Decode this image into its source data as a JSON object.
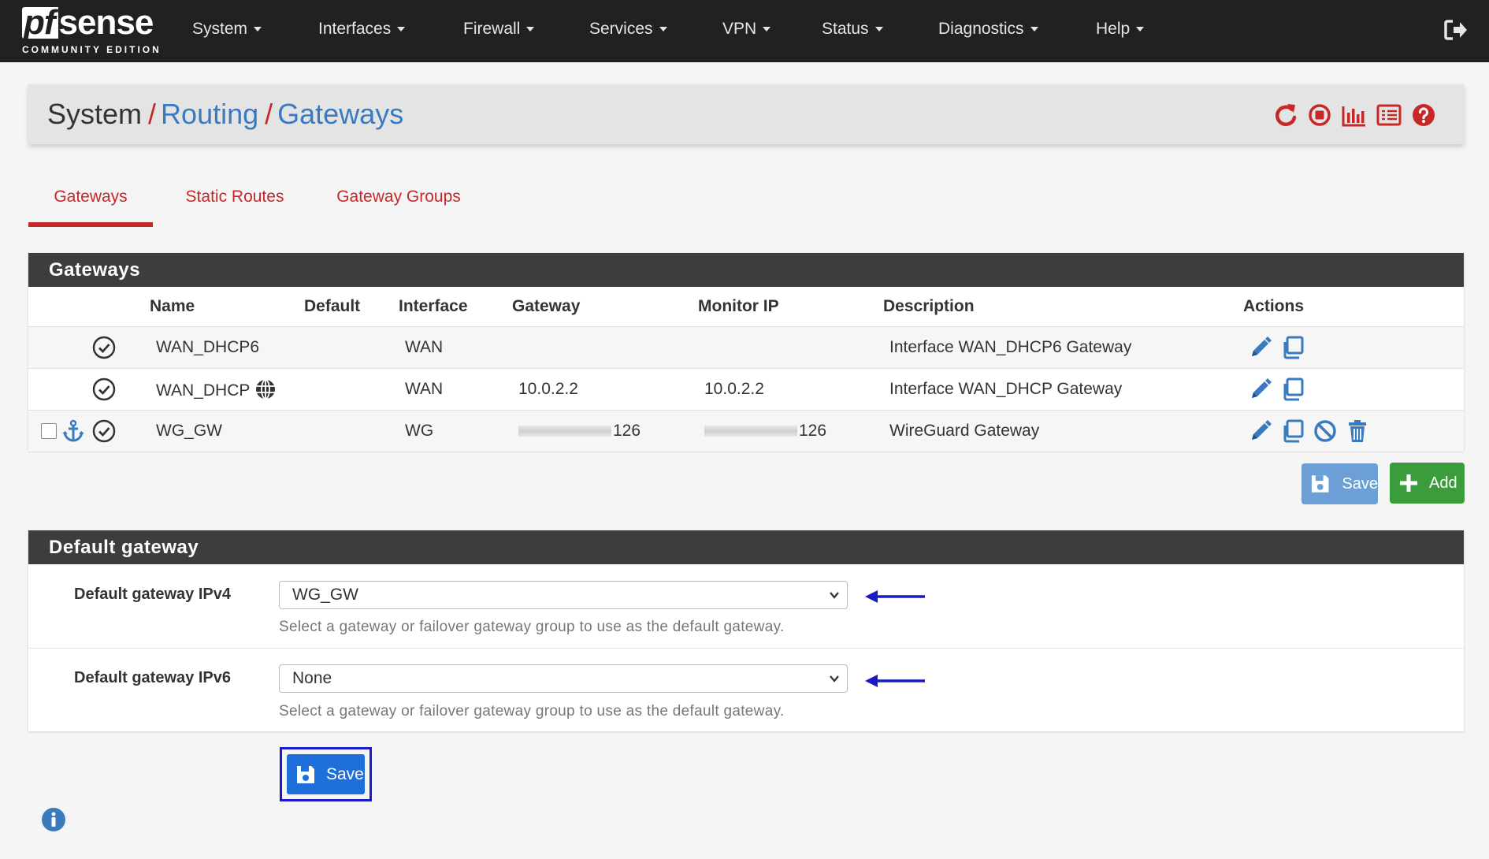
{
  "brand": {
    "logo_main": "sense",
    "logo_pf": "pf",
    "logo_sub": "COMMUNITY EDITION"
  },
  "nav": {
    "items": [
      {
        "label": "System"
      },
      {
        "label": "Interfaces"
      },
      {
        "label": "Firewall"
      },
      {
        "label": "Services"
      },
      {
        "label": "VPN"
      },
      {
        "label": "Status"
      },
      {
        "label": "Diagnostics"
      },
      {
        "label": "Help"
      }
    ]
  },
  "breadcrumb": {
    "root": "System",
    "sep": "/",
    "level1": "Routing",
    "level2": "Gateways"
  },
  "tabs": [
    {
      "label": "Gateways"
    },
    {
      "label": "Static Routes"
    },
    {
      "label": "Gateway Groups"
    }
  ],
  "gateways_panel": {
    "title": "Gateways",
    "columns": [
      "Name",
      "Default",
      "Interface",
      "Gateway",
      "Monitor IP",
      "Description",
      "Actions"
    ],
    "rows": [
      {
        "name": "WAN_DHCP6",
        "interface": "WAN",
        "gateway": "",
        "monitor_ip": "",
        "description": "Interface WAN_DHCP6 Gateway"
      },
      {
        "name": "WAN_DHCP",
        "interface": "WAN",
        "gateway": "10.0.2.2",
        "monitor_ip": "10.0.2.2",
        "description": "Interface WAN_DHCP Gateway"
      },
      {
        "name": "WG_GW",
        "interface": "WG",
        "gateway": "126",
        "monitor_ip": "126",
        "description": "WireGuard Gateway"
      }
    ],
    "save_label": "Save",
    "add_label": "Add"
  },
  "default_gateway_panel": {
    "title": "Default gateway",
    "ipv4_label": "Default gateway IPv4",
    "ipv4_value": "WG_GW",
    "ipv6_label": "Default gateway IPv6",
    "ipv6_value": "None",
    "help": "Select a gateway or failover gateway group to use as the default gateway.",
    "save_label": "Save"
  },
  "colors": {
    "navbar": "#212121",
    "accent_red": "#c62828",
    "link_blue": "#3a7bbf",
    "panel_head": "#3d3d3d",
    "save_blue": "#1e6fd9",
    "add_green": "#3b9c3b",
    "annotation_blue": "#1a1ac8"
  }
}
